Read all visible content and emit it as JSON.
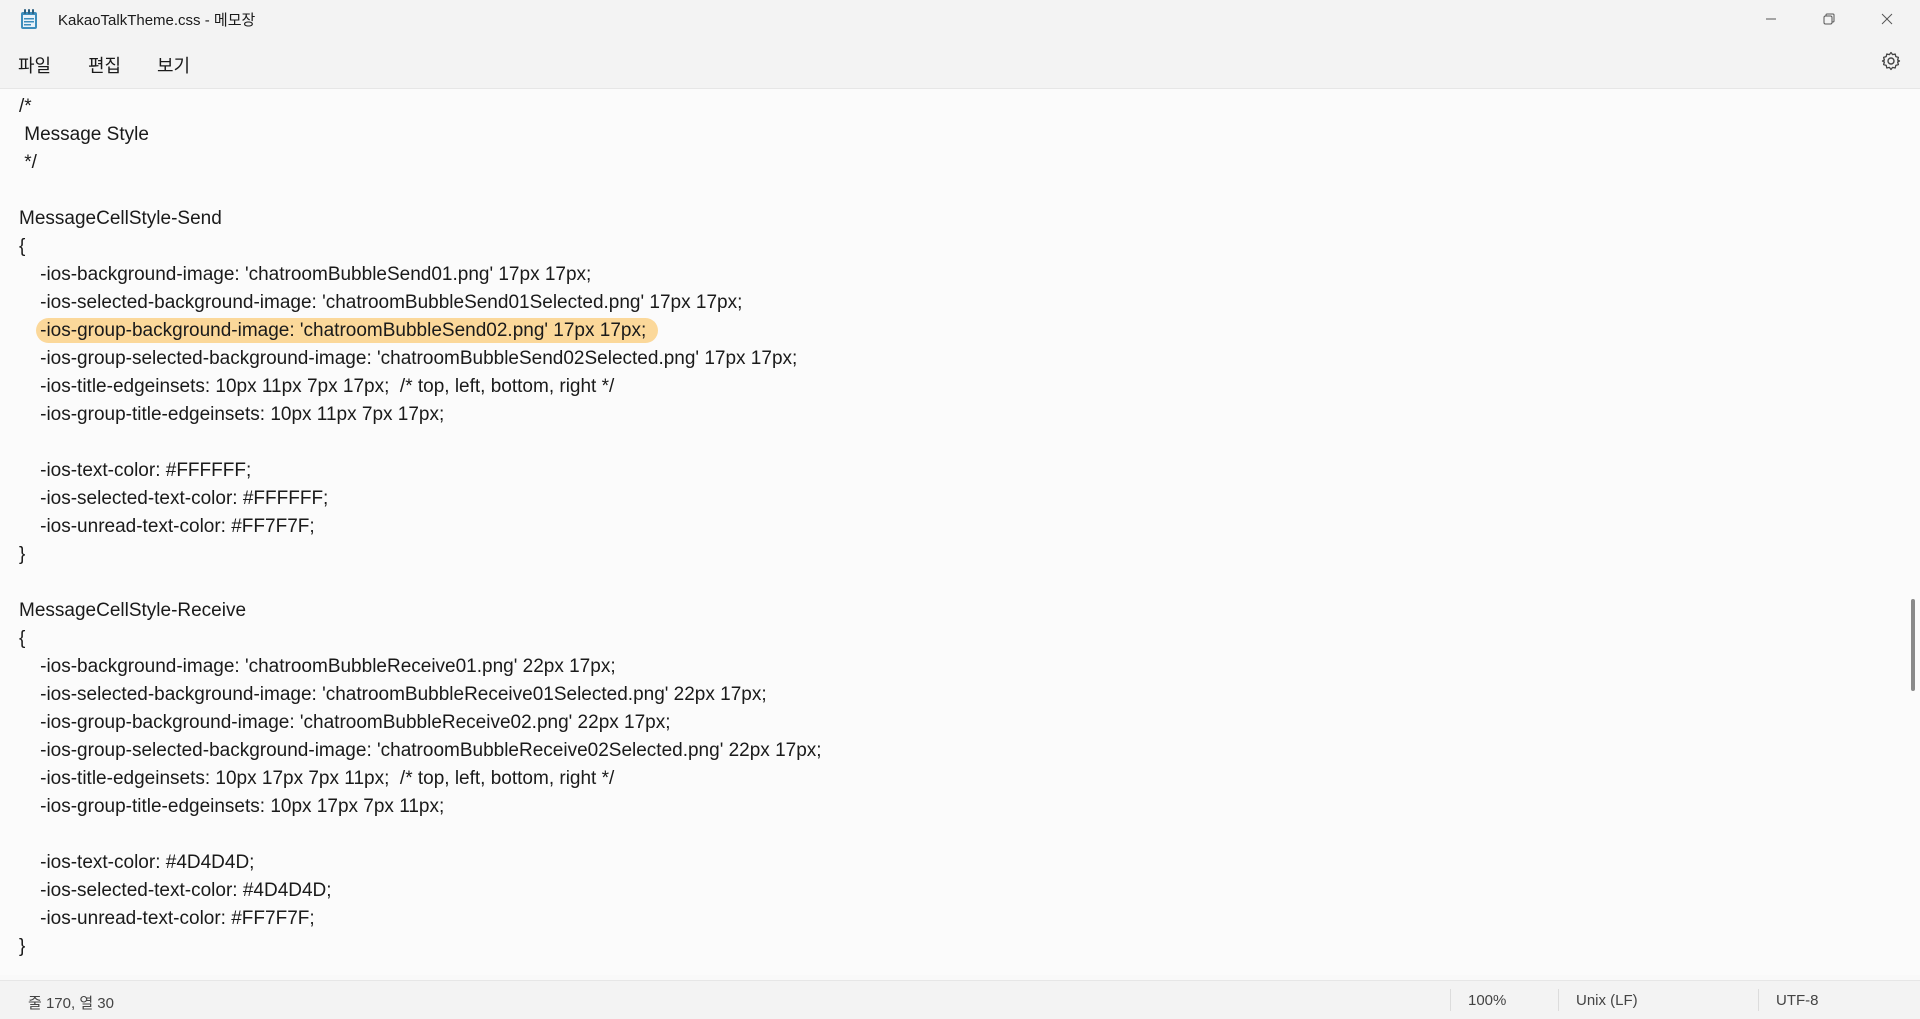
{
  "window": {
    "title": "KakaoTalkTheme.css - 메모장",
    "icon": "notepad-icon"
  },
  "menu": {
    "items": [
      {
        "label": "파일"
      },
      {
        "label": "편집"
      },
      {
        "label": "보기"
      }
    ],
    "settings_icon": "gear-icon"
  },
  "editor": {
    "lines": [
      "/*",
      " Message Style",
      " */",
      "",
      "MessageCellStyle-Send",
      "{",
      "    -ios-background-image: 'chatroomBubbleSend01.png' 17px 17px;",
      "    -ios-selected-background-image: 'chatroomBubbleSend01Selected.png' 17px 17px;",
      "    -ios-group-background-image: 'chatroomBubbleSend02.png' 17px 17px;",
      "    -ios-group-selected-background-image: 'chatroomBubbleSend02Selected.png' 17px 17px;",
      "    -ios-title-edgeinsets: 10px 11px 7px 17px;  /* top, left, bottom, right */",
      "    -ios-group-title-edgeinsets: 10px 11px 7px 17px;",
      "",
      "    -ios-text-color: #FFFFFF;",
      "    -ios-selected-text-color: #FFFFFF;",
      "    -ios-unread-text-color: #FF7F7F;",
      "}",
      "",
      "MessageCellStyle-Receive",
      "{",
      "    -ios-background-image: 'chatroomBubbleReceive01.png' 22px 17px;",
      "    -ios-selected-background-image: 'chatroomBubbleReceive01Selected.png' 22px 17px;",
      "    -ios-group-background-image: 'chatroomBubbleReceive02.png' 22px 17px;",
      "    -ios-group-selected-background-image: 'chatroomBubbleReceive02Selected.png' 22px 17px;",
      "    -ios-title-edgeinsets: 10px 17px 7px 11px;  /* top, left, bottom, right */",
      "    -ios-group-title-edgeinsets: 10px 17px 7px 11px;",
      "",
      "    -ios-text-color: #4D4D4D;",
      "    -ios-selected-text-color: #4D4D4D;",
      "    -ios-unread-text-color: #FF7F7F;",
      "}"
    ],
    "highlighted_line_index": 8,
    "highlight_color": "#FBD89A",
    "selected_text": "-ios-group-background-image: 'chatroomBubbleSend02.png' 17px 17px;"
  },
  "status": {
    "position": "줄 170, 열 30",
    "zoom": "100%",
    "line_ending": "Unix (LF)",
    "encoding": "UTF-8"
  }
}
